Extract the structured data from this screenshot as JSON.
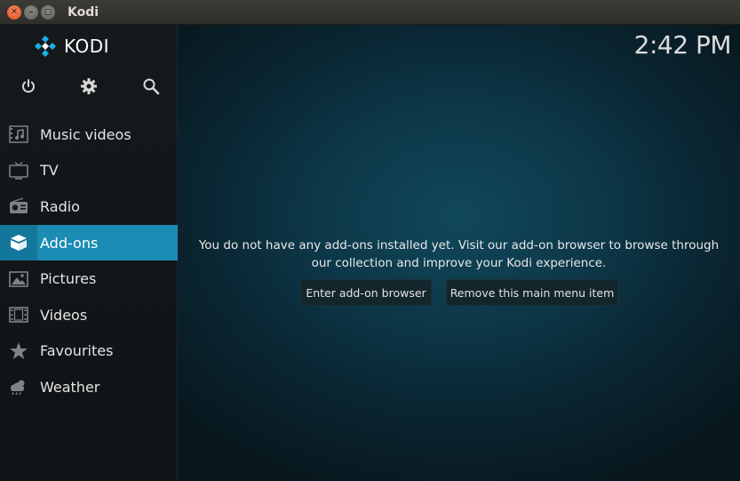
{
  "window": {
    "title": "Kodi",
    "buttons": [
      "close",
      "minimize",
      "maximize"
    ]
  },
  "app": {
    "logo_text": "KODI",
    "clock": "2:42 PM",
    "top_icons": [
      "power-icon",
      "gear-icon",
      "search-icon"
    ],
    "menu": [
      {
        "label": "Music videos",
        "icon": "music-video-icon",
        "active": false
      },
      {
        "label": "TV",
        "icon": "tv-icon",
        "active": false
      },
      {
        "label": "Radio",
        "icon": "radio-icon",
        "active": false
      },
      {
        "label": "Add-ons",
        "icon": "addons-box-icon",
        "active": true
      },
      {
        "label": "Pictures",
        "icon": "picture-icon",
        "active": false
      },
      {
        "label": "Videos",
        "icon": "film-icon",
        "active": false
      },
      {
        "label": "Favourites",
        "icon": "star-icon",
        "active": false
      },
      {
        "label": "Weather",
        "icon": "weather-icon",
        "active": false
      }
    ],
    "message_line1": "You do not have any add-ons installed yet. Visit our add-on browser to browse through",
    "message_line2": "our collection and improve your Kodi experience.",
    "buttons": {
      "enter_browser": "Enter add-on browser",
      "remove_item": "Remove this main menu item"
    }
  },
  "colors": {
    "accent": "#1b8cb3",
    "sidebar": "#13171a",
    "background": "#0d3849"
  }
}
